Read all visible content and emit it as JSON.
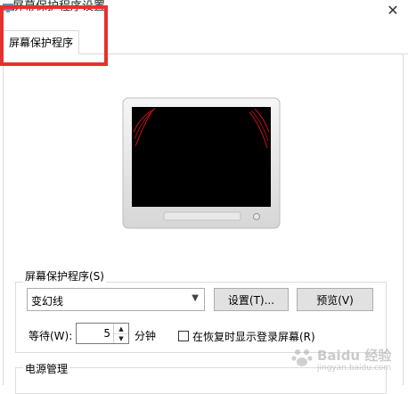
{
  "window": {
    "title": "屏幕保护程序设置",
    "close_symbol": "✕"
  },
  "tab": {
    "label": "屏幕保护程序"
  },
  "screensaver_group": {
    "label": "屏幕保护程序(S)",
    "selected": "变幻线",
    "settings_button": "设置(T)...",
    "preview_button": "预览(V)",
    "wait_label": "等待(W):",
    "wait_value": "5",
    "minutes_label": "分钟",
    "resume_checkbox_label": "在恢复时显示登录屏幕(R)",
    "resume_checked": false
  },
  "power_group": {
    "label": "电源管理"
  },
  "watermark": {
    "text": "Baidu 经验",
    "url": "jingyan.baidu.com"
  },
  "colors": {
    "highlight": "#e8302f",
    "screen": "#000000",
    "screensaver_lines": "#cc1020"
  }
}
